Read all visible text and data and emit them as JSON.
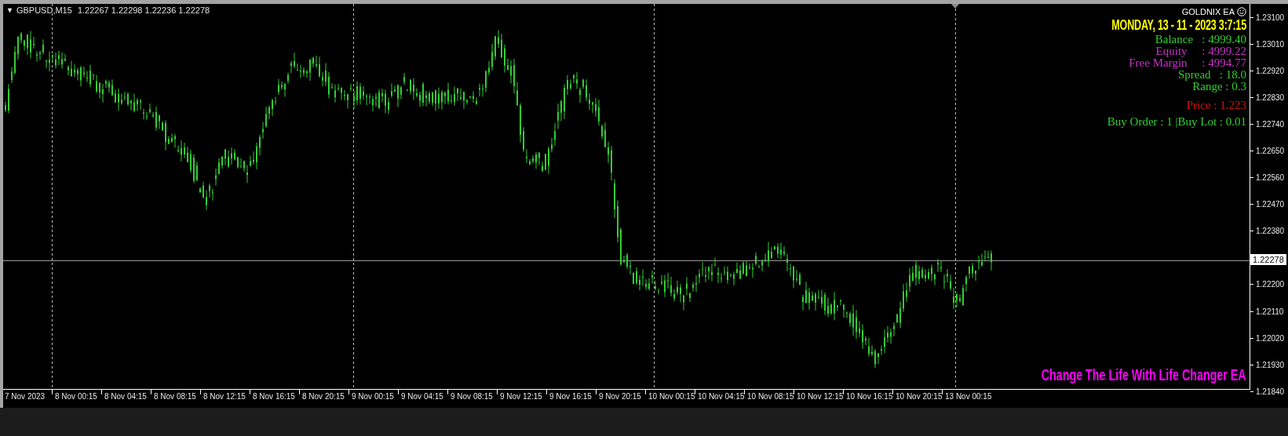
{
  "chart": {
    "menu_glyph": "▼",
    "symbol": "GBPUSD,M15",
    "ohlc": "1.22267 1.22298 1.22236 1.22278",
    "ea_panel": {
      "title": "GOLDNIX EA",
      "datetime": "MONDAY, 13 - 11 - 2023 3:7:15",
      "lines": [
        {
          "text": "Balance   : 4999.40",
          "color": "#32cd32"
        },
        {
          "text": "Equity     : 4999.22",
          "color": "#c832c8"
        },
        {
          "text": "Free Margin     : 4994.77",
          "color": "#c832c8"
        },
        {
          "text": "Spread   : 18.0",
          "color": "#32cd32"
        },
        {
          "text": "Range : 0.3",
          "color": "#32cd32"
        },
        {
          "text": "Price : 1.223",
          "color": "#d21414"
        },
        {
          "text": "Buy Order : 1 |Buy Lot : 0.01",
          "color": "#32cd32"
        }
      ]
    },
    "banner": "Change The Life With Life Changer EA"
  },
  "price_axis": {
    "labels": [
      "1.23100",
      "1.23010",
      "1.22920",
      "1.22830",
      "1.22740",
      "1.22650",
      "1.22560",
      "1.22470",
      "1.22380",
      "1.22200",
      "1.22110",
      "1.22020",
      "1.21930",
      "1.21840"
    ],
    "current_price": "1.22278"
  },
  "time_axis": {
    "labels": [
      "7 Nov 2023",
      "8 Nov 00:15",
      "8 Nov 04:15",
      "8 Nov 08:15",
      "8 Nov 12:15",
      "8 Nov 16:15",
      "8 Nov 20:15",
      "9 Nov 00:15",
      "9 Nov 04:15",
      "9 Nov 08:15",
      "9 Nov 12:15",
      "9 Nov 16:15",
      "9 Nov 20:15",
      "10 Nov 00:15",
      "10 Nov 04:15",
      "10 Nov 08:15",
      "10 Nov 12:15",
      "10 Nov 16:15",
      "10 Nov 20:15",
      "13 Nov 00:15"
    ]
  }
}
